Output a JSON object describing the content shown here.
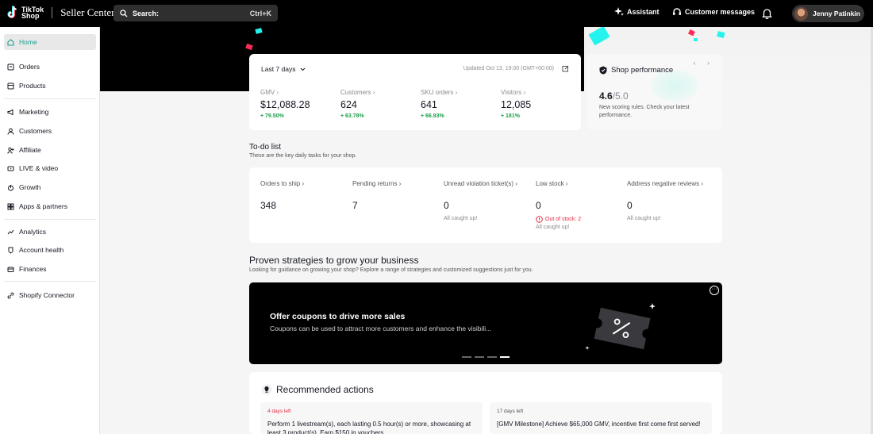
{
  "topbar": {
    "logo_line1": "TikTok",
    "logo_line2": "Shop",
    "seller_center": "Seller Center",
    "search_placeholder": "Search:",
    "search_shortcut": "Ctrl+K",
    "assistant": "Assistant",
    "customer_messages": "Customer messages",
    "user_name": "Jenny Patinkin"
  },
  "sidebar": {
    "items": [
      {
        "label": "Home",
        "icon": "home-icon"
      },
      {
        "label": "Orders",
        "icon": "orders-icon"
      },
      {
        "label": "Products",
        "icon": "products-icon"
      },
      {
        "label": "Marketing",
        "icon": "megaphone-icon"
      },
      {
        "label": "Customers",
        "icon": "customers-icon"
      },
      {
        "label": "Affiliate",
        "icon": "affiliate-icon"
      },
      {
        "label": "LIVE & video",
        "icon": "video-icon"
      },
      {
        "label": "Growth",
        "icon": "growth-icon"
      },
      {
        "label": "Apps & partners",
        "icon": "apps-icon"
      },
      {
        "label": "Analytics",
        "icon": "analytics-icon"
      },
      {
        "label": "Account health",
        "icon": "account-health-icon"
      },
      {
        "label": "Finances",
        "icon": "finances-icon"
      },
      {
        "label": "Shopify Connector",
        "icon": "link-icon"
      }
    ]
  },
  "overview": {
    "period": "Last 7 days",
    "updated": "Updated Oct 13, 19:00 (GMT+00:00)",
    "metrics": [
      {
        "label": "GMV",
        "value": "$12,088.28",
        "change": "+ 79.50%"
      },
      {
        "label": "Customers",
        "value": "624",
        "change": "+ 63.78%"
      },
      {
        "label": "SKU orders",
        "value": "641",
        "change": "+ 66.93%"
      },
      {
        "label": "Visitors",
        "value": "12,085",
        "change": "+ 181%"
      }
    ]
  },
  "performance": {
    "title": "Shop performance",
    "score": "4.6",
    "max": "/5.0",
    "description": "New scoring rules. Check your latest performance."
  },
  "todo": {
    "title": "To-do list",
    "subtitle": "These are the key daily tasks for your shop.",
    "items": [
      {
        "label": "Orders to ship",
        "value": "348",
        "note": "",
        "alert": ""
      },
      {
        "label": "Pending returns",
        "value": "7",
        "note": "",
        "alert": ""
      },
      {
        "label": "Unread violation ticket(s)",
        "value": "0",
        "note": "All caught up!",
        "alert": ""
      },
      {
        "label": "Low stock",
        "value": "0",
        "note": "All caught up!",
        "alert": "Out of stock: 2"
      },
      {
        "label": "Address negative reviews",
        "value": "0",
        "note": "All caught up!",
        "alert": ""
      }
    ]
  },
  "strategies": {
    "title": "Proven strategies to grow your business",
    "subtitle": "Looking for guidance on growing your shop? Explore a range of strategies and customized suggestions just for you.",
    "banner_title": "Offer coupons to drive more sales",
    "banner_subtitle": "Coupons can be used to attract more customers and enhance the visibili...",
    "slide_count": 4,
    "active_slide": 4
  },
  "recommended": {
    "title": "Recommended actions",
    "items": [
      {
        "days": "4 days left",
        "text": "Perform 1 livestream(s), each lasting 0.5 hour(s) or more, showcasing at least 3 product(s). Earn $150 in vouchers",
        "color": "#e02b41"
      },
      {
        "days": "17 days left",
        "text": "[GMV Milestone] Achieve $65,000 GMV, incentive first come first served!",
        "color": "#555555"
      }
    ]
  },
  "colors": {
    "accent": "#1a9d8f",
    "positive": "#1e9e4a",
    "alert": "#e02b41"
  }
}
